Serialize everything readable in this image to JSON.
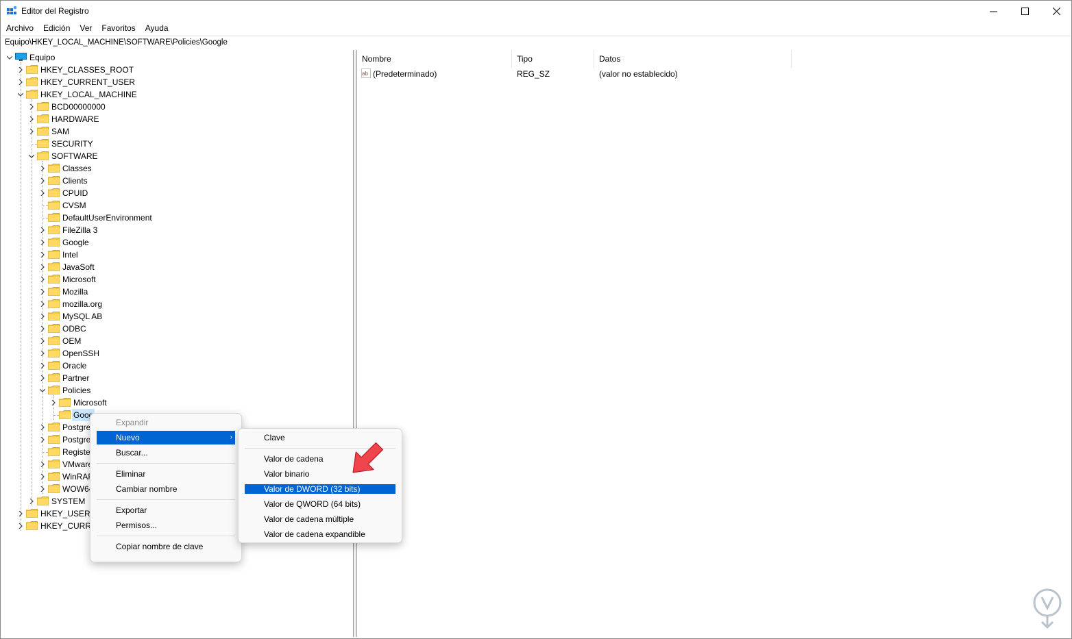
{
  "window": {
    "title": "Editor del Registro"
  },
  "menu": [
    "Archivo",
    "Edición",
    "Ver",
    "Favoritos",
    "Ayuda"
  ],
  "address": "Equipo\\HKEY_LOCAL_MACHINE\\SOFTWARE\\Policies\\Google",
  "tree": {
    "root": "Equipo",
    "hives": {
      "classes_root": "HKEY_CLASSES_ROOT",
      "current_user": "HKEY_CURRENT_USER",
      "local_machine": "HKEY_LOCAL_MACHINE",
      "users": "HKEY_USERS",
      "current_config": "HKEY_CURRE"
    },
    "hklm": [
      "BCD00000000",
      "HARDWARE",
      "SAM",
      "SECURITY",
      "SOFTWARE",
      "SYSTEM"
    ],
    "software": [
      "Classes",
      "Clients",
      "CPUID",
      "CVSM",
      "DefaultUserEnvironment",
      "FileZilla 3",
      "Google",
      "Intel",
      "JavaSoft",
      "Microsoft",
      "Mozilla",
      "mozilla.org",
      "MySQL AB",
      "ODBC",
      "OEM",
      "OpenSSH",
      "Oracle",
      "Partner",
      "Policies"
    ],
    "policies": [
      "Microsoft",
      "Goog"
    ],
    "after_policies": [
      "Postgre",
      "Postgre",
      "Registe",
      "VMware",
      "WinRAF",
      "WOW64"
    ]
  },
  "list": {
    "headers": {
      "name": "Nombre",
      "type": "Tipo",
      "data": "Datos"
    },
    "rows": [
      {
        "name": "(Predeterminado)",
        "type": "REG_SZ",
        "data": "(valor no establecido)"
      }
    ]
  },
  "context_menu": {
    "expand": "Expandir",
    "new": "Nuevo",
    "find": "Buscar...",
    "delete": "Eliminar",
    "rename": "Cambiar nombre",
    "export": "Exportar",
    "permissions": "Permisos...",
    "copy_key_name": "Copiar nombre de clave"
  },
  "submenu": {
    "key": "Clave",
    "string": "Valor de cadena",
    "binary": "Valor binario",
    "dword": "Valor de DWORD (32 bits)",
    "qword": "Valor de QWORD (64 bits)",
    "multi_string": "Valor de cadena múltiple",
    "expand_string": "Valor de cadena expandible"
  },
  "colors": {
    "highlight": "#0064d2",
    "folder": "#f5c842",
    "arrow": "#f0454d"
  }
}
